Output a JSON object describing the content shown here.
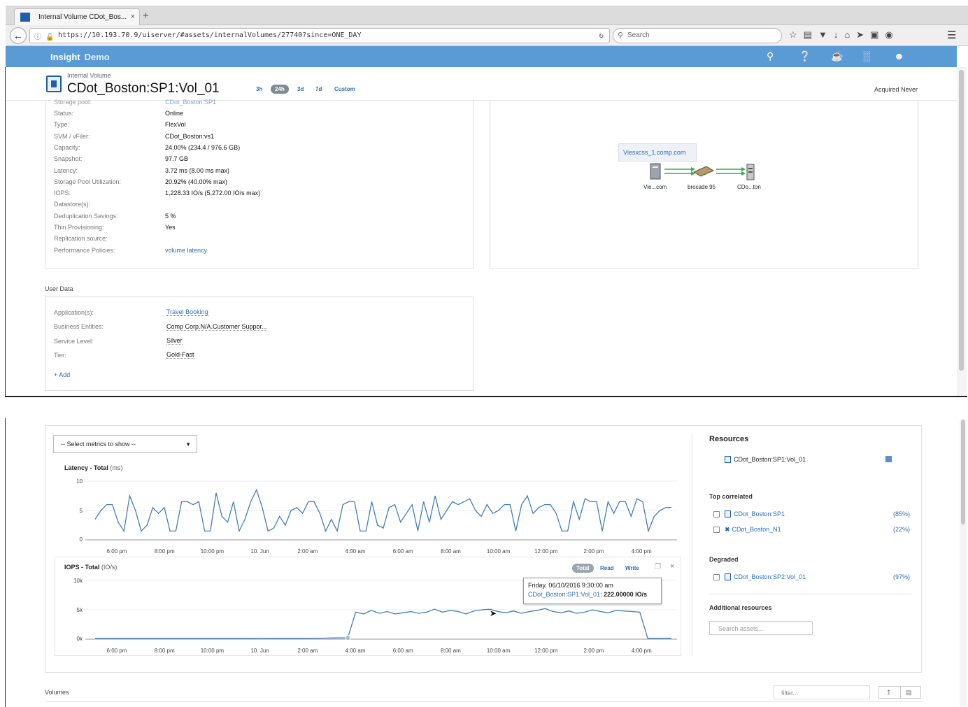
{
  "browser": {
    "tab_title": "Internal Volume CDot_Bos...",
    "tab_close": "×",
    "new_tab": "+",
    "url": "https://10.193.70.9/uiserver/#assets/internalVolumes/27740?since=ONE_DAY",
    "search_placeholder": "Search",
    "icons": [
      "star-icon",
      "reader-icon",
      "pocket-icon",
      "download-icon",
      "home-icon",
      "send-icon",
      "screen-icon",
      "sync-icon",
      "menu-icon"
    ]
  },
  "app": {
    "brand": "Insight",
    "brand_suffix": "Demo",
    "header_icons": [
      "search-icon",
      "help-icon",
      "coffee-icon",
      "reports-icon",
      "user-icon"
    ]
  },
  "page": {
    "subtitle": "Internal Volume",
    "title": "CDot_Boston:SP1:Vol_01",
    "ranges": [
      "3h",
      "24h",
      "3d",
      "7d",
      "Custom"
    ],
    "active_range": "24h",
    "acquired": "Acquired Never"
  },
  "properties": {
    "cut_top_label": "Storage pool:",
    "cut_top_value": "CDot_Boston:SP1",
    "rows": [
      {
        "label": "Status:",
        "value": "Online"
      },
      {
        "label": "Type:",
        "value": "FlexVol"
      },
      {
        "label": "SVM / vFiler:",
        "value": "CDot_Boston:vs1"
      },
      {
        "label": "Capacity:",
        "value": "24.00% (234.4 / 976.6 GB)"
      },
      {
        "label": "Snapshot:",
        "value": "97.7 GB"
      },
      {
        "label": "Latency:",
        "value": "3.72 ms (8.00 ms max)"
      },
      {
        "label": "Storage Pool Utilization:",
        "value": "20.92% (40.00% max)"
      },
      {
        "label": "IOPS:",
        "value": "1,228.33 IO/s (5,272.00 IO/s max)"
      },
      {
        "label": "Datastore(s):",
        "value": ""
      },
      {
        "label": "Deduplication Savings:",
        "value": "5 %"
      },
      {
        "label": "Thin Provisioning:",
        "value": "Yes"
      },
      {
        "label": "Replication source:",
        "value": ""
      },
      {
        "label": "Performance Policies:",
        "value": "volume latency"
      }
    ]
  },
  "topology": {
    "tooltip": "Viesxcss_1.comp.com",
    "nodes": [
      "Vie...com",
      "brocade 95",
      "CDo...ton"
    ]
  },
  "user_data": {
    "title": "User Data",
    "rows": [
      {
        "label": "Application(s):",
        "value": "Travel Booking"
      },
      {
        "label": "Business Entities:",
        "value": "Comp Corp.N/A.Customer Suppor..."
      },
      {
        "label": "Service Level:",
        "value": "Silver"
      },
      {
        "label": "Tier:",
        "value": "Gold-Fast"
      }
    ],
    "add_label": "+ Add"
  },
  "charts": {
    "select_label": "-- Select metrics to show --",
    "latency": {
      "title": "Latency - Total",
      "unit": "(ms)",
      "yticks": [
        "10",
        "5",
        "0"
      ]
    },
    "iops": {
      "title": "IOPS - Total",
      "unit": "(IO/s)",
      "yticks": [
        "10k",
        "5k",
        "0k"
      ],
      "buttons": [
        "Total",
        "Read",
        "Write"
      ],
      "active_button": "Total",
      "close": "×"
    },
    "xticks": [
      "6:00 pm",
      "8:00 pm",
      "10:00 pm",
      "10. Jun",
      "2:00 am",
      "4:00 am",
      "6:00 am",
      "8:00 am",
      "10:00 am",
      "12:00 pm",
      "2:00 pm",
      "4:00 pm"
    ],
    "tooltip": {
      "date": "Friday, 06/10/2016 9:30:00 am",
      "series": "CDot_Boston:SP1:Vol_01",
      "value": "222.00000 IO/s"
    }
  },
  "chart_data": [
    {
      "type": "line",
      "title": "Latency - Total",
      "ylabel": "(ms)",
      "ylim": [
        0,
        10
      ],
      "x_range": [
        "6:00 pm",
        "4:00 pm"
      ],
      "series": [
        {
          "values": [
            3.5,
            5.0,
            6.0,
            6.0,
            3.0,
            1.5,
            7.5,
            5.0,
            1.5,
            2.5,
            5.5,
            4.5,
            5.5,
            1.5,
            1.5,
            6.5,
            6.5,
            6.0,
            6.5,
            1.5,
            1.5,
            8.0,
            4.0,
            3.0,
            6.5,
            1.5,
            3.5,
            6.5,
            8.5,
            5.5,
            1.5,
            2.0,
            4.0,
            2.5,
            5.0,
            5.5,
            4.5,
            6.5,
            6.5,
            4.5,
            1.5,
            3.5,
            1.5,
            6.0,
            6.5,
            6.5,
            1.5,
            1.5,
            6.5,
            2.5,
            2.0,
            5.5,
            6.0,
            3.0,
            4.5,
            6.0,
            1.5,
            6.5,
            3.0,
            7.5,
            3.5,
            5.0,
            6.5,
            6.0,
            6.5,
            7.0,
            5.0,
            4.0,
            6.0,
            4.5,
            5.0,
            6.0,
            6.0,
            1.5,
            6.0,
            7.5,
            4.5,
            5.5,
            6.0,
            6.0,
            4.5,
            1.5,
            1.5,
            6.5,
            3.5,
            7.0,
            6.5,
            6.5,
            1.5,
            6.5,
            4.5,
            6.5,
            6.5,
            4.0,
            7.0,
            6.5,
            1.5,
            4.0,
            5.0,
            5.5,
            5.5
          ]
        }
      ]
    },
    {
      "type": "line",
      "title": "IOPS - Total",
      "ylabel": "(IO/s)",
      "ylim": [
        0,
        10000
      ],
      "x_range": [
        "6:00 pm",
        "4:00 pm"
      ],
      "series": [
        {
          "name": "CDot_Boston:SP1:Vol_01",
          "values": [
            150,
            150,
            160,
            150,
            150,
            160,
            150,
            150,
            160,
            150,
            150,
            150,
            160,
            150,
            150,
            150,
            160,
            150,
            150,
            150,
            160,
            170,
            160,
            150,
            150,
            160,
            150,
            160,
            170,
            180,
            200,
            220,
            222,
            4600,
            4300,
            4900,
            4400,
            4700,
            4300,
            4500,
            4700,
            4400,
            4600,
            5100,
            4600,
            4900,
            4700,
            4300,
            4800,
            5000,
            5100,
            4700,
            4500,
            4800,
            4400,
            4700,
            4900,
            5200,
            4700,
            4500,
            4800,
            4400,
            4600,
            5000,
            4700,
            4500,
            4900,
            4800,
            4700,
            4600,
            150,
            150,
            160,
            150
          ]
        }
      ]
    }
  ],
  "resources": {
    "title": "Resources",
    "main_item": "CDot_Boston:SP1:Vol_01",
    "main_color": "#5b8fd0",
    "top_correlated_title": "Top correlated",
    "top_correlated": [
      {
        "name": "CDot_Boston:SP1",
        "pct": "(85%)"
      },
      {
        "name": "CDot_Boston_N1",
        "pct": "(22%)"
      }
    ],
    "degraded_title": "Degraded",
    "degraded": [
      {
        "name": "CDot_Boston:SP2:Vol_01",
        "pct": "(97%)"
      }
    ],
    "additional_title": "Additional resources",
    "search_placeholder": "Search assets..."
  },
  "volumes": {
    "label": "Volumes",
    "filter_placeholder": "filter..."
  },
  "colors": {
    "app_bar": "#5b9bd5",
    "link": "#2a6ebb",
    "series": "#3f7fb8"
  }
}
